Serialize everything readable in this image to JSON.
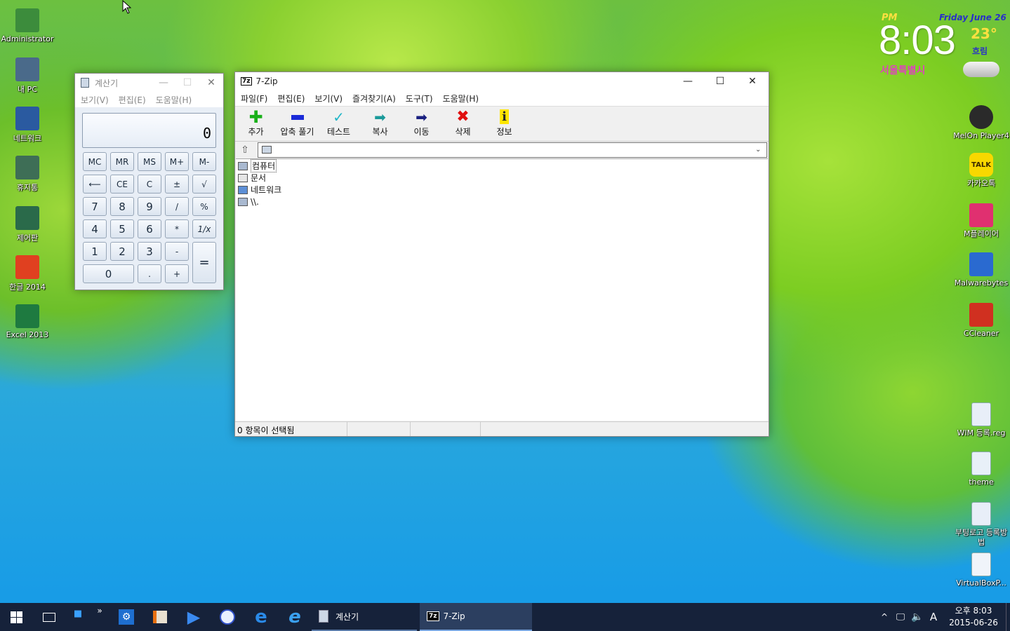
{
  "desktop_left": [
    {
      "label": "Administrator",
      "icon": "user-folder-icon"
    },
    {
      "label": "내 PC",
      "icon": "computer-icon"
    },
    {
      "label": "네트워크",
      "icon": "network-globe-icon"
    },
    {
      "label": "휴지통",
      "icon": "recycle-bin-icon"
    },
    {
      "label": "제어판",
      "icon": "control-panel-icon"
    },
    {
      "label": "한글 2014",
      "icon": "hwp-icon"
    },
    {
      "label": "Excel 2013",
      "icon": "excel-icon"
    }
  ],
  "desktop_right": [
    {
      "label": "MelOn Player4",
      "icon": "melon-icon"
    },
    {
      "label": "카카오톡",
      "icon": "kakaotalk-icon",
      "badge": "TALK"
    },
    {
      "label": "M플레이어",
      "icon": "mplayer-icon"
    },
    {
      "label": "Malwarebytes",
      "icon": "malwarebytes-icon"
    },
    {
      "label": "CCleaner",
      "icon": "ccleaner-icon"
    },
    {
      "label": "WIM 등록.reg",
      "icon": "reg-file-icon"
    },
    {
      "label": "theme",
      "icon": "theme-file-icon"
    },
    {
      "label": "부팅로고 등록방법",
      "icon": "document-icon"
    },
    {
      "label": "VirtualBoxP...",
      "icon": "virtualbox-file-icon"
    }
  ],
  "clock_widget": {
    "ampm": "PM",
    "date": "Friday June 26",
    "time": "8:03",
    "temp": "23°",
    "weather": "흐림",
    "city": "서울특별시"
  },
  "calculator": {
    "title": "계산기",
    "menu": [
      "보기(V)",
      "편집(E)",
      "도움말(H)"
    ],
    "display": "0",
    "keys": {
      "mc": "MC",
      "mr": "MR",
      "ms": "MS",
      "mplus": "M+",
      "mminus": "M-",
      "back": "⟵",
      "ce": "CE",
      "c": "C",
      "pm": "±",
      "sqrt": "√",
      "k7": "7",
      "k8": "8",
      "k9": "9",
      "div": "/",
      "pct": "%",
      "k4": "4",
      "k5": "5",
      "k6": "6",
      "mul": "*",
      "inv": "1/x",
      "k1": "1",
      "k2": "2",
      "k3": "3",
      "sub": "-",
      "eq": "=",
      "k0": "0",
      "dot": ".",
      "add": "+"
    }
  },
  "zip": {
    "title": "7-Zip",
    "menu": [
      "파일(F)",
      "편집(E)",
      "보기(V)",
      "즐겨찾기(A)",
      "도구(T)",
      "도움말(H)"
    ],
    "toolbar": [
      {
        "label": "추가",
        "icon": "add-plus-icon",
        "color": "#19b019"
      },
      {
        "label": "압축 풀기",
        "icon": "extract-minus-icon",
        "color": "#1a2bd8"
      },
      {
        "label": "테스트",
        "icon": "test-check-icon",
        "color": "#1fb6c8"
      },
      {
        "label": "복사",
        "icon": "copy-arrow-icon",
        "color": "#1a9a9a"
      },
      {
        "label": "이동",
        "icon": "move-arrow-icon",
        "color": "#1a2080"
      },
      {
        "label": "삭제",
        "icon": "delete-x-icon",
        "color": "#e01010"
      },
      {
        "label": "정보",
        "icon": "info-icon",
        "color": "#d8b800"
      }
    ],
    "address": "",
    "files": [
      "컴퓨터",
      "문서",
      "네트워크",
      "\\\\."
    ],
    "status": "0 항목이 선택됨"
  },
  "taskbar": {
    "apps": [
      "계산기",
      "7-Zip"
    ],
    "tray_time": "오후 8:03",
    "tray_date": "2015-06-26",
    "ime": "A"
  }
}
